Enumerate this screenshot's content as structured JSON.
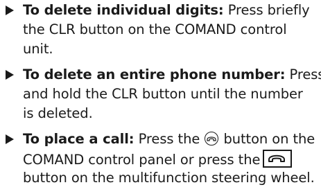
{
  "instructions": [
    {
      "bold": "To delete individual digits:",
      "line1_rest": " Press briefly",
      "line2": "the CLR button on the COMAND control",
      "line3": "unit."
    },
    {
      "bold": "To delete an entire phone number:",
      "line1_rest": " Press",
      "line2": "and hold the CLR button until the number",
      "line3": "is deleted."
    },
    {
      "bold": "To place a call:",
      "line1_pre_icon": " Press the ",
      "line1_post_icon": " button on the",
      "line2_pre_icon": "COMAND control panel or press the",
      "line3": "button on the multifunction steering wheel."
    }
  ],
  "icons": {
    "control_panel_call_button": "phone-handset-round-icon",
    "steering_wheel_call_button": "phone-handset-box-icon"
  }
}
